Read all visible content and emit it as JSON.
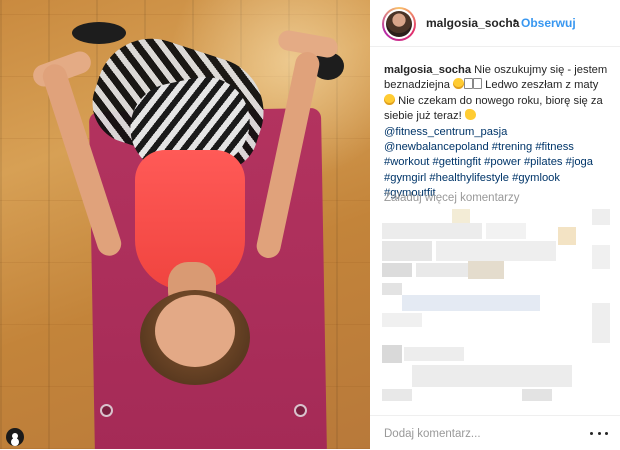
{
  "post": {
    "username": "malgosia_socha",
    "separator": "•",
    "follow_label": "Obserwuj"
  },
  "caption": {
    "username": "malgosia_socha",
    "text_1": "Nie oszukujmy się - jestem beznadziejna",
    "text_2": "Ledwo zeszłam z maty",
    "text_3": "Nie czekam do nowego roku, biorę się za siebie już teraz!",
    "hashtags": [
      "@fitness_centrum_pasja",
      "@newbalancepoland",
      "#trening",
      "#fitness",
      "#workout",
      "#gettingfit",
      "#power",
      "#pilates",
      "#joga",
      "#gymgirl",
      "#healthylifestyle",
      "#gymlook",
      "#gymoutfit"
    ]
  },
  "comments": {
    "load_more_label": "Załaduj więcej komentarzy"
  },
  "add_comment": {
    "placeholder": "Dodaj komentarz..."
  },
  "icons": {
    "more": "more-options-icon",
    "user_tag": "user-tag-icon",
    "avatar": "avatar"
  },
  "colors": {
    "link": "#3897f0",
    "hashtag": "#003569",
    "muted": "#999999",
    "text": "#262626"
  }
}
